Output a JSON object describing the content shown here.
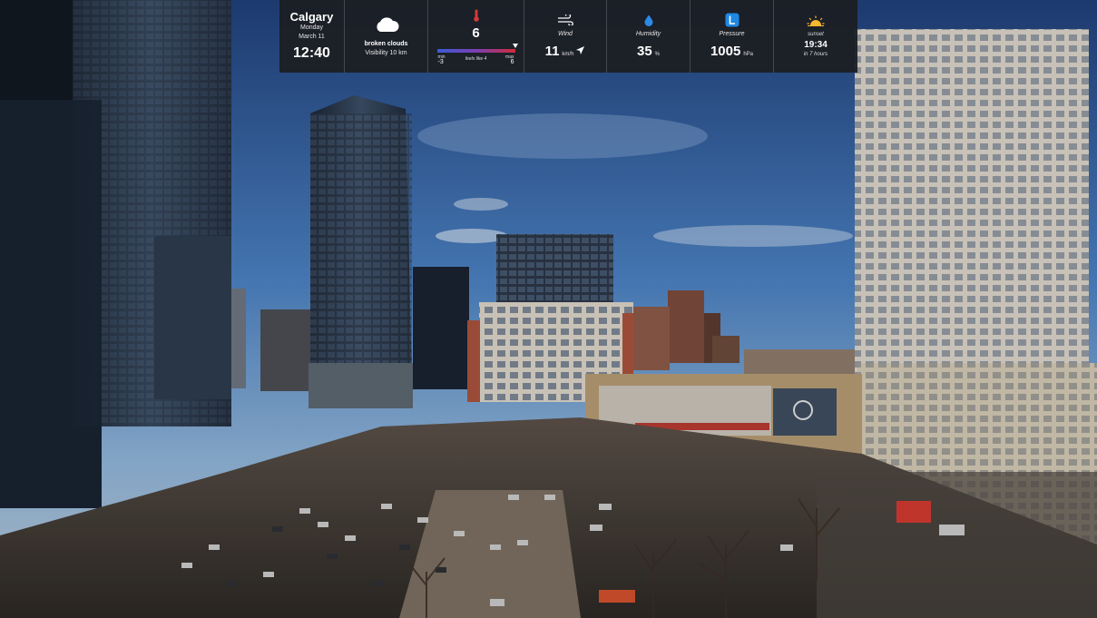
{
  "location": {
    "city": "Calgary",
    "day": "Monday",
    "date": "March 11",
    "time": "12:40"
  },
  "condition": {
    "icon": "cloud-icon",
    "text": "broken clouds",
    "visibility": "Visibility 10 km"
  },
  "temperature": {
    "icon": "thermometer-icon",
    "value": "6",
    "min_label": "min",
    "max_label": "max",
    "min": "-3",
    "max": "6",
    "feels_like": "feels like 4"
  },
  "wind": {
    "icon": "wind-icon",
    "label": "Wind",
    "value": "11",
    "unit": "km/h",
    "direction_icon": "direction-arrow-icon"
  },
  "humidity": {
    "icon": "water-drop-icon",
    "label": "Humidity",
    "value": "35",
    "unit": "%"
  },
  "pressure": {
    "icon": "pressure-icon",
    "label": "Pressure",
    "value": "1005",
    "unit": "hPa"
  },
  "sunset": {
    "icon": "sunset-icon",
    "label": "sunset",
    "time": "19:34",
    "in": "in 7 hours"
  },
  "colors": {
    "panel": "#1c1e22",
    "accent_blue": "#1e88e5",
    "sun": "#f5b82e",
    "temp_cold": "#3a5bd8",
    "temp_hot": "#d02a3a"
  },
  "background": {
    "icon": "city-skyline-photo"
  }
}
